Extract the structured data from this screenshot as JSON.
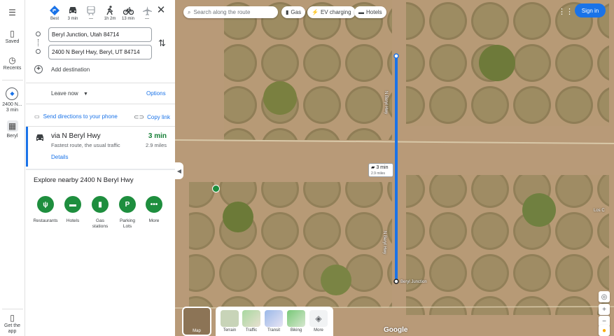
{
  "rail": {
    "saved": "Saved",
    "recents": "Recents",
    "recent1_label": "2400 N...",
    "recent1_time": "3 min",
    "recent2_label": "Beryl",
    "get_app": "Get the app"
  },
  "modes": {
    "best": "Best",
    "drive": "3 min",
    "transit": "—",
    "walk": "1h 2m",
    "bike": "13 min",
    "flight": "—"
  },
  "origin": {
    "value": "Beryl Junction, Utah 84714"
  },
  "destination": {
    "value": "2400 N Beryl Hwy, Beryl, UT 84714"
  },
  "add_destination": "Add destination",
  "leave_now": "Leave now",
  "options": "Options",
  "send_directions": "Send directions to your phone",
  "copy_link": "Copy link",
  "route": {
    "via": "via N Beryl Hwy",
    "summary": "Fastest route, the usual traffic",
    "time": "3 min",
    "distance": "2.9 miles",
    "details": "Details"
  },
  "explore": {
    "title": "Explore nearby 2400 N Beryl Hwy",
    "categories": [
      {
        "label": "Restaurants",
        "icon": "restaurant-icon"
      },
      {
        "label": "Hotels",
        "icon": "hotel-icon"
      },
      {
        "label": "Gas stations",
        "icon": "gas-icon"
      },
      {
        "label": "Parking Lots",
        "icon": "parking-icon"
      },
      {
        "label": "More",
        "icon": "more-icon"
      }
    ]
  },
  "map": {
    "search_placeholder": "Search along the route",
    "chips": [
      "Gas",
      "EV charging",
      "Hotels"
    ],
    "sign_in": "Sign in",
    "badge_time": "3 min",
    "badge_dist": "2.9 miles",
    "layer_label": "Map",
    "layers": [
      "Terrain",
      "Traffic",
      "Transit",
      "Biking",
      "More"
    ],
    "road_label": "N Beryl Hwy",
    "place_label": "Beryl Junction",
    "place_label2": "Los C",
    "logo": "Google",
    "colors": {
      "route": "#1a73e8",
      "accent": "#1a73e8",
      "category": "#1e8e3e"
    }
  }
}
